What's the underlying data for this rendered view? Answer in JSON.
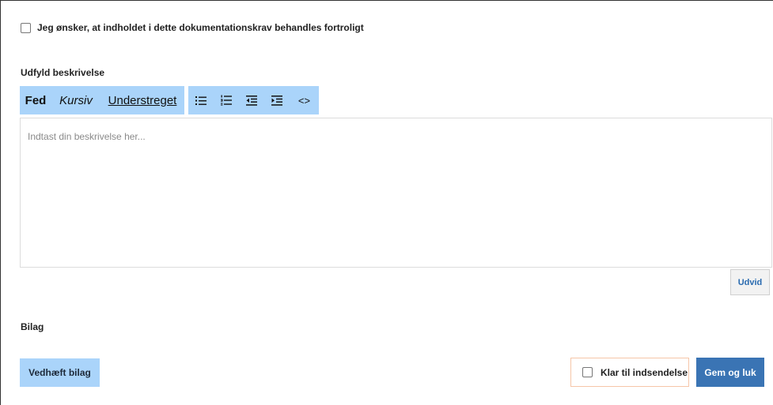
{
  "confidential": {
    "label": "Jeg ønsker, at indholdet i dette dokumentationskrav behandles fortroligt",
    "checked": false
  },
  "description": {
    "heading": "Udfyld beskrivelse",
    "toolbar": {
      "bold": "Fed",
      "italic": "Kursiv",
      "underline": "Understreget",
      "bullet_list_icon": "bullet-list-icon",
      "numbered_list_icon": "numbered-list-icon",
      "outdent_icon": "outdent-icon",
      "indent_icon": "indent-icon",
      "code": "<>"
    },
    "placeholder": "Indtast din beskrivelse her...",
    "expand_button": "Udvid"
  },
  "attachments": {
    "heading": "Bilag",
    "attach_button": "Vedhæft bilag"
  },
  "footer": {
    "ready_label": "Klar til indsendelse",
    "ready_checked": false,
    "save_button": "Gem og luk"
  },
  "colors": {
    "toolbar_bg": "#aad4fa",
    "primary_button": "#3a74b4",
    "link_text": "#2a6bb0",
    "ready_border": "#f6c6a8"
  }
}
